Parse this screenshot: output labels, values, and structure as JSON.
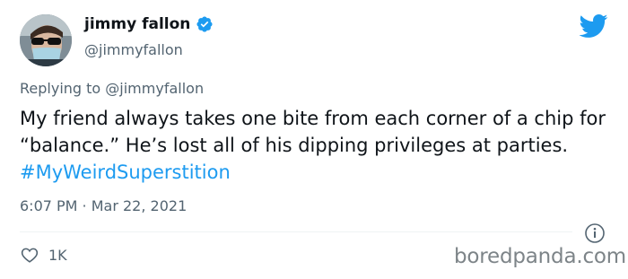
{
  "author": {
    "name": "jimmy fallon",
    "handle": "@jimmyfallon",
    "verified": true
  },
  "reply": {
    "text": "Replying to @jimmyfallon"
  },
  "tweet": {
    "text": "My friend always takes one bite from each corner of a chip for “balance.” He’s lost all of his dipping privileges at parties. ",
    "hashtag": "#MyWeirdSuperstition"
  },
  "meta": {
    "timestamp": "6:07 PM · Mar 22, 2021"
  },
  "actions": {
    "likes": "1K"
  },
  "watermark": "boredpanda.com",
  "colors": {
    "accent": "#1d9bf0",
    "secondary_text": "#536471",
    "watermark": "#7d8488"
  },
  "icons": [
    "avatar",
    "verified-badge-icon",
    "twitter-bird-icon",
    "info-icon",
    "heart-icon"
  ]
}
